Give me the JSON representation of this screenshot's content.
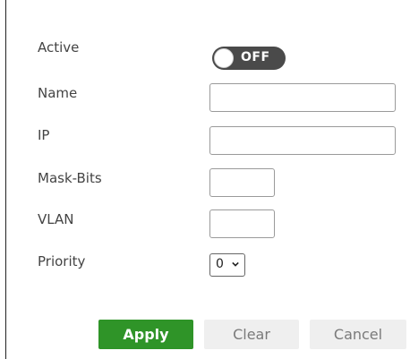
{
  "form": {
    "labels": {
      "active": "Active",
      "name": "Name",
      "ip": "IP",
      "mask_bits": "Mask-Bits",
      "vlan": "VLAN",
      "priority": "Priority"
    },
    "active_toggle": {
      "state_text": "OFF"
    },
    "inputs": {
      "name_value": "",
      "ip_value": "",
      "mask_bits_value": "",
      "vlan_value": ""
    },
    "priority_select": {
      "selected": "0"
    }
  },
  "buttons": {
    "apply": "Apply",
    "clear": "Clear",
    "cancel": "Cancel"
  },
  "colors": {
    "apply_bg": "#2f9428",
    "toggle_off_bg": "#4a4a4a",
    "secondary_btn_bg": "#efefef"
  },
  "icons": {
    "priority_dropdown": "chevron-down-icon"
  }
}
